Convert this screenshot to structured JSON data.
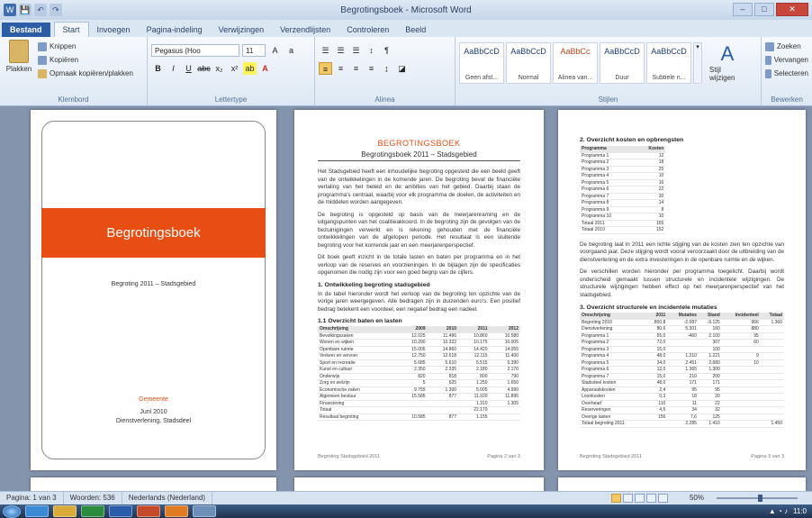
{
  "window": {
    "title": "Begrotingsboek - Microsoft Word"
  },
  "qat": [
    "W",
    "💾",
    "↶",
    "↷"
  ],
  "tabs": [
    {
      "label": "Bestand"
    },
    {
      "label": "Start"
    },
    {
      "label": "Invoegen"
    },
    {
      "label": "Pagina-indeling"
    },
    {
      "label": "Verwijzingen"
    },
    {
      "label": "Verzendlijsten"
    },
    {
      "label": "Controleren"
    },
    {
      "label": "Beeld"
    }
  ],
  "ribbon": {
    "clipboard": {
      "label": "Klembord",
      "paste": "Plakken",
      "cut": "Knippen",
      "copy": "Kopiëren",
      "format_painter": "Opmaak kopiëren/plakken"
    },
    "font": {
      "label": "Lettertype",
      "name": "Pegasus (Hoo",
      "size": "11",
      "buttons": [
        "B",
        "I",
        "U",
        "abc",
        "x₂",
        "x²",
        "A"
      ]
    },
    "paragraph": {
      "label": "Alinea",
      "buttons": [
        "☰",
        "☰",
        "☰",
        "≡",
        "¶",
        "≡",
        "≡",
        "≡",
        "≡"
      ]
    },
    "styles": {
      "label": "Stijlen",
      "items": [
        {
          "preview": "AaBbCcD",
          "name": "Geen afst..."
        },
        {
          "preview": "AaBbCcD",
          "name": "Normal"
        },
        {
          "preview": "AaBbCc",
          "name": "Alinea van..."
        },
        {
          "preview": "AaBbCcD",
          "name": "Duur"
        },
        {
          "preview": "AaBbCcD",
          "name": "Subtiele n..."
        }
      ],
      "change": "Stijl wijzigen"
    },
    "editing": {
      "label": "Bewerken",
      "find": "Zoeken",
      "replace": "Vervangen",
      "select": "Selecteren"
    }
  },
  "pages": {
    "cover": {
      "title": "Begrotingsboek",
      "subtitle": "Begroting 2011 – Stadsgebied",
      "footer_red": "Gemeente",
      "footer_lines": [
        "Juni 2010",
        "Dienstverlening, Stadsdeel"
      ]
    },
    "page2": {
      "title": "BEGROTINGSBOEK",
      "subtitle": "Begrotingsboek 2011 – Stadsgebied",
      "paragraphs": [
        "Het Stadsgebied heeft een inhoudelijke begroting opgesteld die een beeld geeft van de ontwikkelingen in de komende jaren. De begroting bevat de financiële vertaling van het beleid en de ambities van het gebied. Daarbij staan de programma's centraal, waarbij voor elk programma de doelen, de activiteiten en de middelen worden aangegeven.",
        "De begroting is opgesteld op basis van de meerjarenraming en de uitgangspunten van het coalitieakkoord. In de begroting zijn de gevolgen van de bezuinigingen verwerkt en is rekening gehouden met de financiële ontwikkelingen van de afgelopen periode. Het resultaat is een sluitende begroting voor het komende jaar en een meerjarenperspectief.",
        "Dit boek geeft inzicht in de totale lasten en baten per programma en in het verloop van de reserves en voorzieningen. In de bijlagen zijn de specificaties opgenomen die nodig zijn voor een goed begrip van de cijfers."
      ],
      "section_title": "1. Ontwikkeling begroting stadsgebied",
      "section_text": "In de tabel hieronder wordt het verloop van de begroting ten opzichte van de vorige jaren weergegeven. Alle bedragen zijn in duizenden euro's. Een positief bedrag betekent een voordeel, een negatief bedrag een nadeel.",
      "table_title": "1.1 Overzicht baten en lasten",
      "table": [
        [
          "Omschrijving",
          "2009",
          "2010",
          "2011",
          "2012"
        ],
        [
          "Bevolkingszaken",
          "12.025",
          "11.496",
          "10.860",
          "10.580"
        ],
        [
          "Wonen en wijken",
          "10.290",
          "10.322",
          "10.175",
          "10.005"
        ],
        [
          "Openbare ruimte",
          "15.005",
          "14.860",
          "14.420",
          "14.055"
        ],
        [
          "Verkeer en vervoer",
          "12.750",
          "12.618",
          "12.115",
          "11.400"
        ],
        [
          "Sport en recreatie",
          "5.685",
          "5.610",
          "5.515",
          "5.390"
        ],
        [
          "Kunst en cultuur",
          "2.350",
          "2.335",
          "2.180",
          "2.170"
        ],
        [
          "Onderwijs",
          "820",
          "818",
          "800",
          "790"
        ],
        [
          "Zorg en welzijn",
          "5",
          "625",
          "1.250",
          "1.650"
        ],
        [
          "Economische zaken",
          "9.755",
          "1.300",
          "5.005",
          "4.990"
        ],
        [
          "Algemeen bestuur",
          "15.585",
          "877",
          "11.920",
          "11.895"
        ],
        [
          "Financiering",
          "",
          "",
          "1.310",
          "1.305"
        ],
        [
          "Totaal",
          "",
          "",
          "22.170",
          ""
        ],
        [
          "Resultaat begroting",
          "10.585",
          "877",
          "1.155",
          ""
        ]
      ],
      "footer_left": "Begroting Stadsgebied 2011",
      "footer_right": "Pagina 2 van 3"
    },
    "page3": {
      "title1": "2. Overzicht kosten en opbrengsten",
      "table1": [
        [
          "Programma",
          "Kosten"
        ],
        [
          "Programma 1",
          "12"
        ],
        [
          "Programma 2",
          "18"
        ],
        [
          "Programma 3",
          "25"
        ],
        [
          "Programma 4",
          "10"
        ],
        [
          "Programma 5",
          "16"
        ],
        [
          "Programma 6",
          "22"
        ],
        [
          "Programma 7",
          "30"
        ],
        [
          "Programma 8",
          "14"
        ],
        [
          "Programma 9",
          "8"
        ],
        [
          "Programma 10",
          "10"
        ],
        [
          "Totaal 2011",
          "165"
        ],
        [
          "Totaal 2010",
          "152"
        ]
      ],
      "paragraphs": [
        "De begroting laat in 2011 een lichte stijging van de kosten zien ten opzichte van voorgaand jaar. Deze stijging wordt vooral veroorzaakt door de uitbreiding van de dienstverlening en de extra investeringen in de openbare ruimte en de wijken.",
        "De verschillen worden hieronder per programma toegelicht. Daarbij wordt onderscheid gemaakt tussen structurele en incidentele wijzigingen. De structurele wijzigingen hebben effect op het meerjarenperspectief van het stadsgebied."
      ],
      "title2": "3. Overzicht structurele en incidentele mutaties",
      "table2": [
        [
          "Omschrijving",
          "2011",
          "Mutaties",
          "Stand",
          "Incidenteel",
          "Totaal"
        ],
        [
          "Begroting 2010",
          "800,8",
          "-2.087",
          "-9.125",
          "966",
          "1.360"
        ],
        [
          "Dienstverlening",
          "80,6",
          "5.301",
          "160",
          "880",
          ""
        ],
        [
          "Programma 1",
          "55,0",
          "-460",
          "2.100",
          "95",
          ""
        ],
        [
          "Programma 2",
          "72,0",
          "",
          "307",
          "60",
          ""
        ],
        [
          "Programma 3",
          "15,0",
          "",
          "100",
          "",
          ""
        ],
        [
          "Programma 4",
          "48,0",
          "1.210",
          "1.221",
          "9",
          ""
        ],
        [
          "Programma 5",
          "34,0",
          "2.451",
          "2.680",
          "10",
          ""
        ],
        [
          "Programma 6",
          "12,0",
          "1.365",
          "1.300",
          "",
          ""
        ],
        [
          "Programma 7",
          "15,0",
          "210",
          "200",
          "",
          ""
        ],
        [
          "Stadsdeel kosten",
          "48,0",
          "171",
          "171",
          "",
          ""
        ],
        [
          "Apparaatskosten",
          "2,4",
          "95",
          "95",
          "",
          ""
        ],
        [
          "Loonkosten",
          "0,3",
          "18",
          "20",
          "",
          ""
        ],
        [
          "Overhead",
          "110",
          "11",
          "22",
          "",
          ""
        ],
        [
          "Reserveringen",
          "4,5",
          "34",
          "32",
          "",
          ""
        ],
        [
          "Overige lasten",
          "156",
          "7,6",
          "125",
          "",
          ""
        ],
        [
          "Totaal begroting 2011",
          "",
          "2.285",
          "1.410",
          "",
          "1.450"
        ]
      ],
      "footer_left": "Begroting Stadsgebied 2011",
      "footer_right": "Pagina 3 van 3"
    }
  },
  "status": {
    "page": "Pagina: 1 van 3",
    "words": "Woorden: 536",
    "language": "Nederlands (Nederland)",
    "zoom": "50%"
  },
  "tray": {
    "time": "11:0"
  }
}
